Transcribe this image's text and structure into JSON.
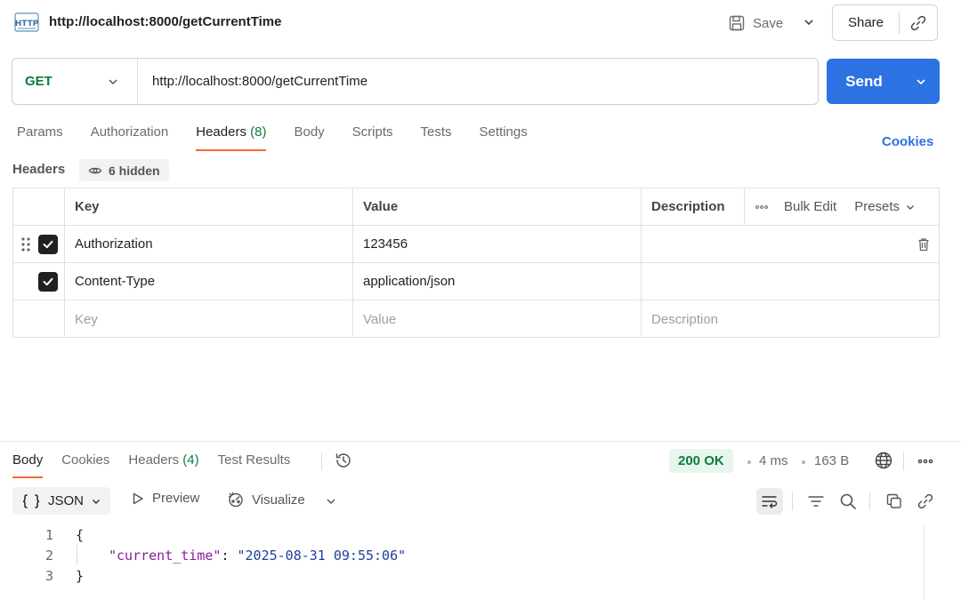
{
  "request": {
    "icon_text": "HTTP",
    "title": "http://localhost:8000/getCurrentTime",
    "save_label": "Save",
    "share_label": "Share",
    "method": "GET",
    "url": "http://localhost:8000/getCurrentTime",
    "send_label": "Send",
    "tabs": [
      {
        "label": "Params"
      },
      {
        "label": "Authorization"
      },
      {
        "label": "Headers",
        "count": "(8)"
      },
      {
        "label": "Body"
      },
      {
        "label": "Scripts"
      },
      {
        "label": "Tests"
      },
      {
        "label": "Settings"
      }
    ],
    "cookies_label": "Cookies"
  },
  "headers": {
    "label": "Headers",
    "hidden_label": "6 hidden",
    "columns": {
      "key": "Key",
      "value": "Value",
      "description": "Description"
    },
    "bulk_edit_label": "Bulk Edit",
    "presets_label": "Presets",
    "rows": [
      {
        "key": "Authorization",
        "value": "123456",
        "checked": true
      },
      {
        "key": "Content-Type",
        "value": "application/json",
        "checked": true
      }
    ],
    "placeholders": {
      "key": "Key",
      "value": "Value",
      "description": "Description"
    }
  },
  "response": {
    "tabs": [
      {
        "label": "Body"
      },
      {
        "label": "Cookies"
      },
      {
        "label": "Headers",
        "count": "(4)"
      },
      {
        "label": "Test Results"
      }
    ],
    "status": "200 OK",
    "time": "4 ms",
    "size": "163 B",
    "format_label": "JSON",
    "preview_label": "Preview",
    "visualize_label": "Visualize",
    "code_lines": [
      {
        "num": "1",
        "text": "{"
      },
      {
        "num": "2",
        "key": "\"current_time\"",
        "sep": ": ",
        "value": "\"2025-08-31 09:55:06\""
      },
      {
        "num": "3",
        "text": "}"
      }
    ]
  },
  "colors": {
    "accent": "#2c72e2",
    "method_get": "#0b7d3e",
    "tab_underline": "#f26b3a",
    "status_ok_bg": "#e7f5ec"
  },
  "icons": [
    "http-icon",
    "save-icon",
    "chevron-down-icon",
    "link-icon",
    "eye-icon",
    "grip-icon",
    "checkbox-icon",
    "trash-icon",
    "more-icon",
    "history-icon",
    "globe-icon",
    "braces-icon",
    "play-icon",
    "visualize-icon",
    "wrap-icon",
    "filter-icon",
    "search-icon",
    "copy-icon"
  ]
}
